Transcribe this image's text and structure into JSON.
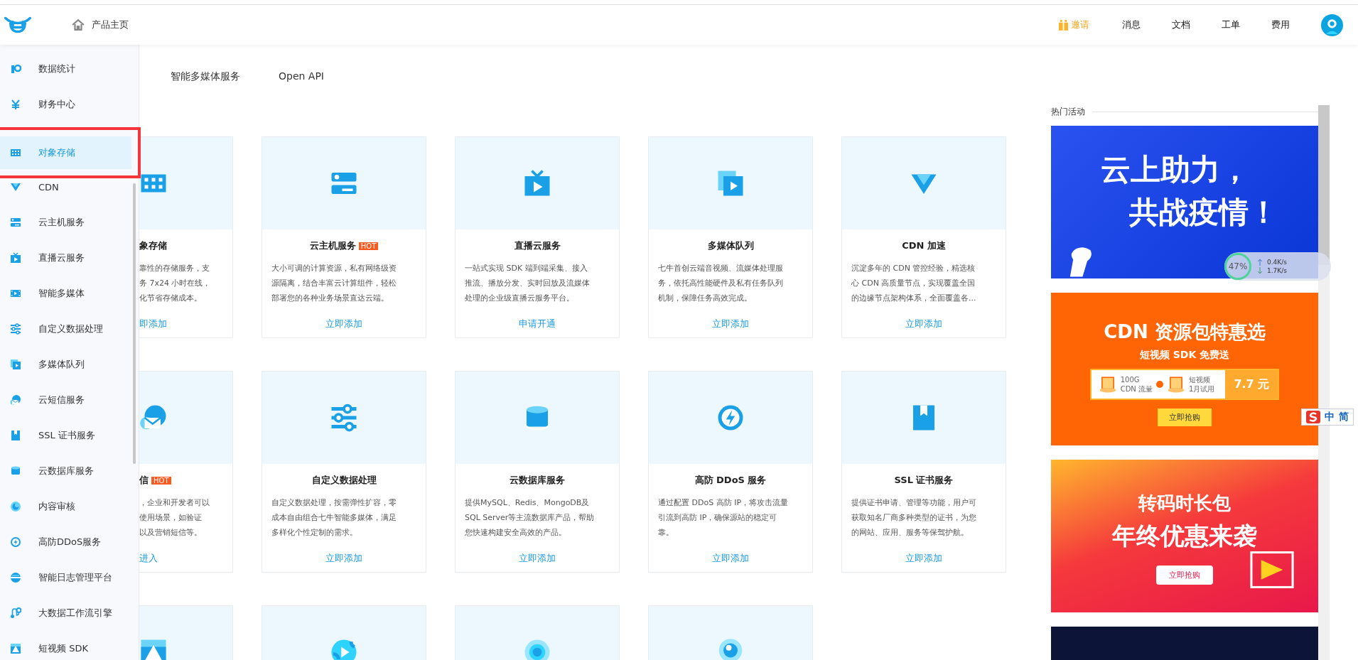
{
  "header": {
    "breadcrumb": "产品主页",
    "nav": [
      {
        "label": "邀请",
        "kind": "invite"
      },
      {
        "label": "消息",
        "kind": "link"
      },
      {
        "label": "文档",
        "kind": "link"
      },
      {
        "label": "工单",
        "kind": "link"
      },
      {
        "label": "费用",
        "kind": "link"
      }
    ]
  },
  "sidebar": {
    "items": [
      {
        "label": "数据统计",
        "selected": false,
        "annotated": false
      },
      {
        "label": "财务中心",
        "selected": false,
        "annotated": false
      },
      {
        "label": "对象存储",
        "selected": true,
        "annotated": true
      },
      {
        "label": "CDN",
        "selected": false,
        "annotated": false
      },
      {
        "label": "云主机服务",
        "selected": false,
        "annotated": false
      },
      {
        "label": "直播云服务",
        "selected": false,
        "annotated": false
      },
      {
        "label": "智能多媒体",
        "selected": false,
        "annotated": false
      },
      {
        "label": "自定义数据处理",
        "selected": false,
        "annotated": false
      },
      {
        "label": "多媒体队列",
        "selected": false,
        "annotated": false
      },
      {
        "label": "云短信服务",
        "selected": false,
        "annotated": false
      },
      {
        "label": "SSL 证书服务",
        "selected": false,
        "annotated": false
      },
      {
        "label": "云数据库服务",
        "selected": false,
        "annotated": false
      },
      {
        "label": "内容审核",
        "selected": false,
        "annotated": false
      },
      {
        "label": "高防DDoS服务",
        "selected": false,
        "annotated": false
      },
      {
        "label": "智能日志管理平台",
        "selected": false,
        "annotated": false
      },
      {
        "label": "大数据工作流引擎",
        "selected": false,
        "annotated": false
      },
      {
        "label": "短视频 SDK",
        "selected": false,
        "annotated": false
      }
    ]
  },
  "tabs": [
    {
      "label": "智能多媒体服务",
      "selected": false
    },
    {
      "label": "Open API",
      "selected": false
    }
  ],
  "cards": [
    [
      {
        "cut_off": true,
        "title": "象存储",
        "description_lines": [
          "靠性的存储服务，支",
          "务 7x24 小时在线，",
          "化节省存储成本。"
        ],
        "action": "即添加"
      },
      {
        "cut_off": false,
        "title": "云主机服务",
        "badge": "HOT",
        "description_lines": [
          "大小可调的计算资源，私有网络级资",
          "源隔离，结合丰富云计算组件，轻松",
          "部署您的各种业务场景直达云端。"
        ],
        "action": "立即添加"
      },
      {
        "cut_off": false,
        "title": "直播云服务",
        "description_lines": [
          "一站式实现 SDK 端到端采集、接入",
          "推流、播放分发、实时回放及流媒体",
          "处理的企业级直播云服务平台。"
        ],
        "action": "申请开通"
      },
      {
        "cut_off": false,
        "title": "多媒体队列",
        "description_lines": [
          "七牛首创云端音视频、流媒体处理服",
          "务，依托高性能硬件及私有任务队列",
          "机制，保障任务高效完成。"
        ],
        "action": "立即添加"
      },
      {
        "cut_off": false,
        "title": "CDN 加速",
        "description_lines": [
          "沉淀多年的 CDN 管控经验，精选核",
          "心 CDN 高质量节点，实现覆盖全国",
          "的边缘节点架构体系，全面覆盖各..."
        ],
        "action": "立即添加"
      }
    ],
    [
      {
        "cut_off": true,
        "title": "信",
        "badge": "HOT",
        "description_lines": [
          "，企业和开发者可以",
          "使用场景，如验证",
          "以及营销短信等。"
        ],
        "action": "进入"
      },
      {
        "cut_off": false,
        "title": "自定义数据处理",
        "description_lines": [
          "自定义数据处理，按需弹性扩容，零",
          "成本自由组合七牛智能多媒体，满足",
          "多样化个性定制的需求。"
        ],
        "action": "立即添加"
      },
      {
        "cut_off": false,
        "title": "云数据库服务",
        "description_lines": [
          "提供MySQL、Redis、MongoDB及",
          "SQL Server等主流数据库产品，帮助",
          "您快速构建安全高效的产品。"
        ],
        "action": "立即添加"
      },
      {
        "cut_off": false,
        "title": "高防 DDoS 服务",
        "description_lines": [
          "通过配置 DDoS 高防 IP，将攻击流量",
          "引流到高防 IP，确保源站的稳定可",
          "靠。"
        ],
        "action": "立即添加"
      },
      {
        "cut_off": false,
        "title": "SSL 证书服务",
        "description_lines": [
          "提供证书申请、管理等功能，用户可",
          "获取知名厂商多种类型的证书，为您",
          "的网站、应用、服务等保驾护航。"
        ],
        "action": "立即添加"
      }
    ],
    [
      {
        "cut_off": true
      },
      {
        "cut_off": false
      },
      {
        "cut_off": false
      },
      {
        "cut_off": false
      }
    ]
  ],
  "hot_events": {
    "title": "热门活动",
    "banners": [
      {
        "kind": "blue",
        "lines": [
          "云上助力，",
          "共战疫情！"
        ]
      },
      {
        "kind": "orange",
        "title": "CDN 资源包特惠选",
        "subtitle": "短视频 SDK 免费送",
        "offer": [
          {
            "amount": "100G",
            "desc": "CDN 流量"
          },
          {
            "amount": "短视频",
            "desc": "1月试用"
          }
        ],
        "price": "7.7 元",
        "button": "立即抢购"
      },
      {
        "kind": "red",
        "lines": [
          "转码时长包",
          "年终优惠来袭"
        ],
        "button": "立即抢购"
      },
      {
        "kind": "navy"
      }
    ]
  },
  "speed_widget": {
    "percent": "47%",
    "upload": "0.4K/s",
    "download": "1.7K/s"
  },
  "ime_toolbar": {
    "labels": [
      "中",
      "简"
    ]
  }
}
